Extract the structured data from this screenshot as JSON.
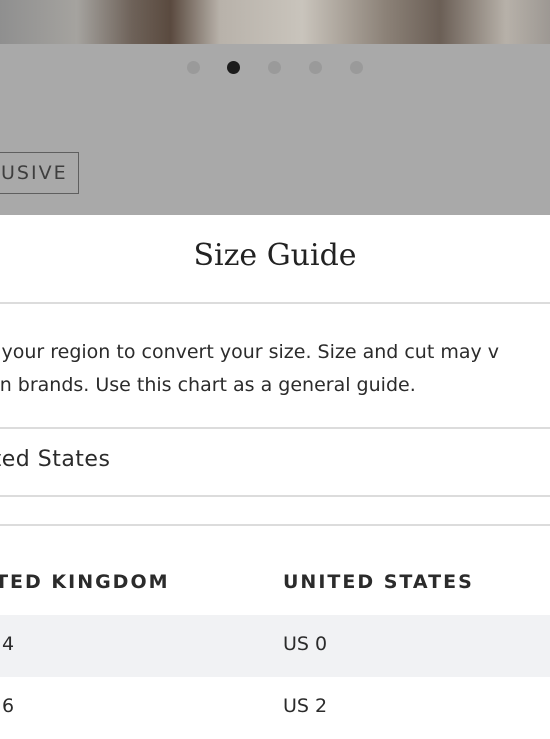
{
  "background": {
    "carousel": {
      "count": 5,
      "active_index": 1
    },
    "badge": "USIVE"
  },
  "size_guide": {
    "title": "Size Guide",
    "description_lines": [
      "t your region to convert your size. Size and cut may v",
      "en brands. Use this chart as a general guide."
    ],
    "region_selected": "ited States",
    "table": {
      "headers": [
        "ITED KINGDOM",
        "UNITED STATES"
      ],
      "rows": [
        [
          "4",
          "US 0"
        ],
        [
          "6",
          "US 2"
        ]
      ]
    }
  }
}
